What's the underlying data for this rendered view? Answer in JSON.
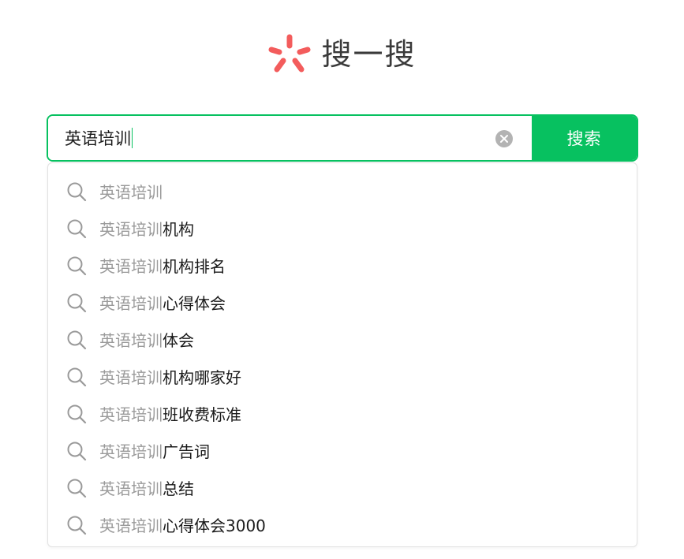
{
  "header": {
    "title": "搜一搜",
    "logo_icon": "wechat-search-logo-icon",
    "logo_color": "#f35c5c"
  },
  "search": {
    "value": "英语培训",
    "button_label": "搜索",
    "clear_icon": "clear-circle-icon",
    "accent_color": "#07c160"
  },
  "suggestions": {
    "icon": "search-icon",
    "items": [
      {
        "query": "英语培训",
        "rest": ""
      },
      {
        "query": "英语培训",
        "rest": "机构"
      },
      {
        "query": "英语培训",
        "rest": "机构排名"
      },
      {
        "query": "英语培训",
        "rest": "心得体会"
      },
      {
        "query": "英语培训",
        "rest": "体会"
      },
      {
        "query": "英语培训",
        "rest": "机构哪家好"
      },
      {
        "query": "英语培训",
        "rest": "班收费标准"
      },
      {
        "query": "英语培训",
        "rest": "广告词"
      },
      {
        "query": "英语培训",
        "rest": "总结"
      },
      {
        "query": "英语培训",
        "rest": "心得体会3000"
      }
    ]
  }
}
